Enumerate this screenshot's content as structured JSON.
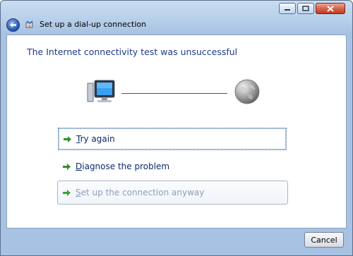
{
  "window": {
    "title": "Set up a dial-up connection",
    "controls": [
      "minimize",
      "maximize",
      "close"
    ]
  },
  "content": {
    "heading": "The Internet connectivity test was unsuccessful",
    "icons": {
      "computer": "computer-icon",
      "globe": "globe-icon"
    }
  },
  "options": {
    "try_again": {
      "mnemonic": "T",
      "rest": "ry again"
    },
    "diagnose": {
      "mnemonic": "D",
      "rest": "iagnose the problem"
    },
    "setup_anyway": {
      "mnemonic": "S",
      "rest": "et up the connection anyway"
    }
  },
  "footer": {
    "cancel": "Cancel"
  },
  "colors": {
    "heading": "#1e3a8a",
    "arrow": "#2f8f2f",
    "setup_text": "#8aa0bb"
  }
}
